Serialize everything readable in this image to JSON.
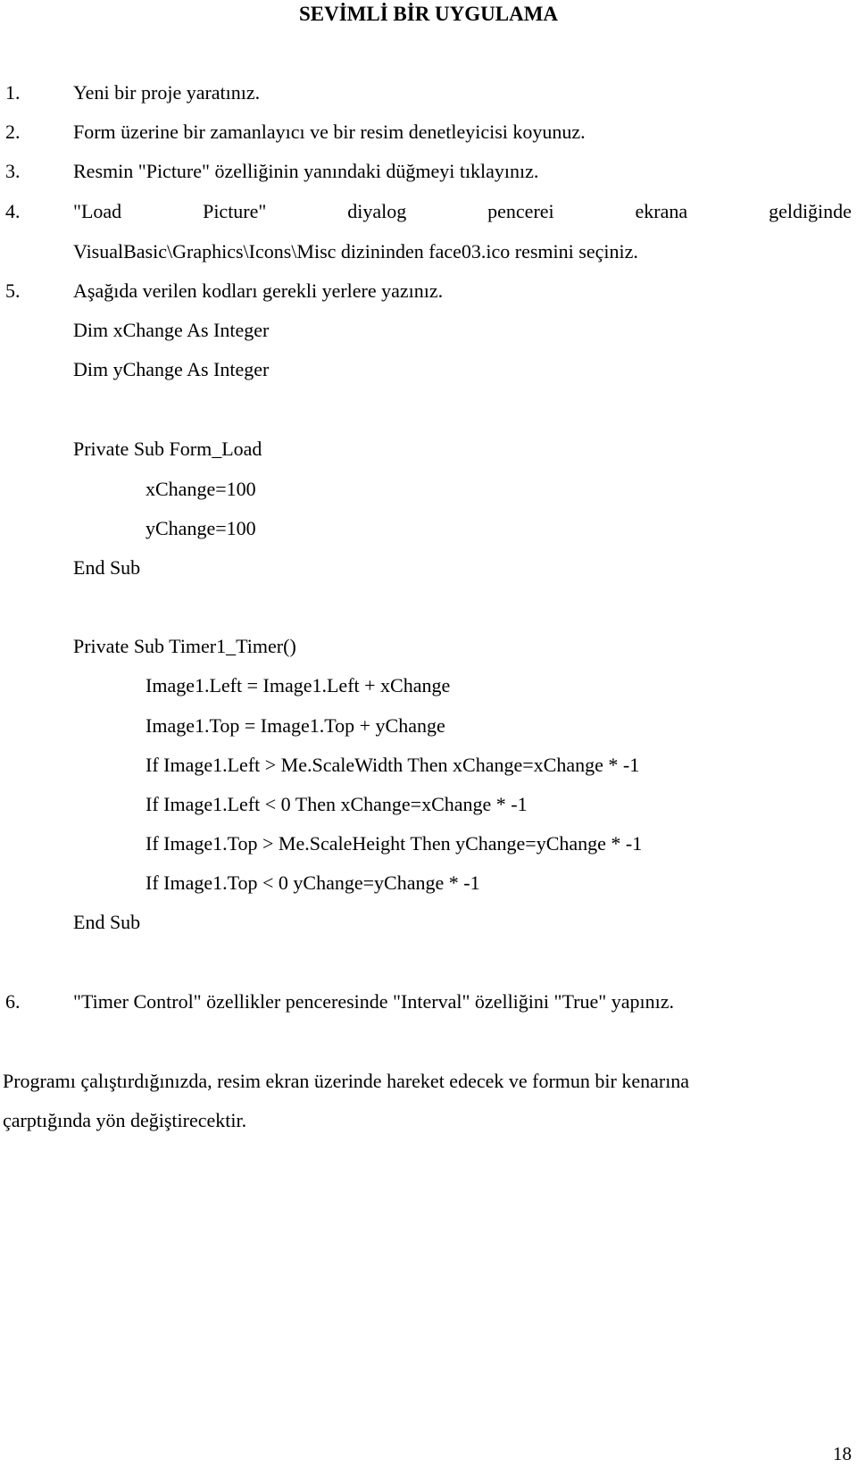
{
  "title": "SEVİMLİ BİR UYGULAMA",
  "steps": [
    {
      "num": "1.",
      "text": "Yeni bir proje yaratınız."
    },
    {
      "num": "2.",
      "text": "Form üzerine bir zamanlayıcı ve bir resim denetleyicisi koyunuz."
    },
    {
      "num": "3.",
      "text": "Resmin \"Picture\" özelliğinin yanındaki düğmeyi tıklayınız."
    },
    {
      "num": "4.",
      "words": [
        "\"Load",
        "Picture\"",
        "diyalog",
        "pencerei",
        "ekrana",
        "geldiğinde"
      ],
      "continuation": "VisualBasic\\Graphics\\Icons\\Misc dizininden face03.ico resmini seçiniz."
    },
    {
      "num": "5.",
      "text": "Aşağıda verilen kodları gerekli yerlere yazınız."
    },
    {
      "num": "6.",
      "text": "\"Timer Control\" özellikler penceresinde \"Interval\" özelliğini \"True\" yapınız."
    }
  ],
  "code": {
    "declarations": [
      "Dim xChange As Integer",
      "Dim yChange As Integer"
    ],
    "form_load": {
      "header": "Private Sub Form_Load",
      "body": [
        "xChange=100",
        "yChange=100"
      ],
      "footer": "End Sub"
    },
    "timer": {
      "header": "Private Sub Timer1_Timer()",
      "body": [
        "Image1.Left = Image1.Left + xChange",
        "Image1.Top = Image1.Top + yChange",
        "If Image1.Left > Me.ScaleWidth Then xChange=xChange * -1",
        "If Image1.Left < 0 Then xChange=xChange * -1",
        "If Image1.Top > Me.ScaleHeight Then yChange=yChange * -1",
        "If Image1.Top < 0 yChange=yChange * -1"
      ],
      "footer": "End Sub"
    }
  },
  "closing_paragraph": {
    "line1": "Programı çalıştırdığınızda, resim ekran üzerinde hareket edecek ve formun bir kenarına",
    "line2": "çarptığında yön değiştirecektir."
  },
  "page_number": "18"
}
